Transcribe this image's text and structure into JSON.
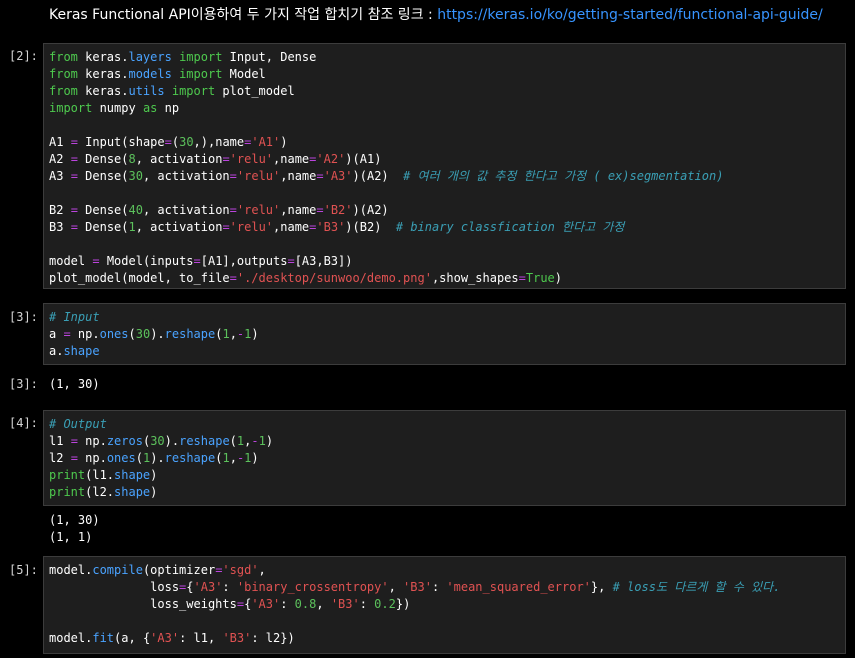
{
  "markdown": {
    "text": "Keras Functional API이용하여 두 가지 작업 합치기 참조 링크 : ",
    "link": "https://keras.io/ko/getting-started/functional-api-guide/"
  },
  "cells": [
    {
      "prompt": "[2]:",
      "lines": [
        [
          [
            "kw",
            "from"
          ],
          [
            "pl",
            " keras."
          ],
          [
            "attr",
            "layers"
          ],
          [
            "pl",
            " "
          ],
          [
            "kw",
            "import"
          ],
          [
            "pl",
            " Input, Dense"
          ]
        ],
        [
          [
            "kw",
            "from"
          ],
          [
            "pl",
            " keras."
          ],
          [
            "attr",
            "models"
          ],
          [
            "pl",
            " "
          ],
          [
            "kw",
            "import"
          ],
          [
            "pl",
            " Model"
          ]
        ],
        [
          [
            "kw",
            "from"
          ],
          [
            "pl",
            " keras."
          ],
          [
            "attr",
            "utils"
          ],
          [
            "pl",
            " "
          ],
          [
            "kw",
            "import"
          ],
          [
            "pl",
            " plot_model"
          ]
        ],
        [
          [
            "kw",
            "import"
          ],
          [
            "pl",
            " numpy "
          ],
          [
            "kw",
            "as"
          ],
          [
            "pl",
            " np"
          ]
        ],
        [],
        [
          [
            "pl",
            "A1 "
          ],
          [
            "op",
            "="
          ],
          [
            "pl",
            " Input(shape"
          ],
          [
            "op",
            "="
          ],
          [
            "pl",
            "("
          ],
          [
            "num",
            "30"
          ],
          [
            "pl",
            ",),name"
          ],
          [
            "op",
            "="
          ],
          [
            "str",
            "'A1'"
          ],
          [
            "pl",
            ")"
          ]
        ],
        [
          [
            "pl",
            "A2 "
          ],
          [
            "op",
            "="
          ],
          [
            "pl",
            " Dense("
          ],
          [
            "num",
            "8"
          ],
          [
            "pl",
            ", activation"
          ],
          [
            "op",
            "="
          ],
          [
            "str",
            "'relu'"
          ],
          [
            "pl",
            ",name"
          ],
          [
            "op",
            "="
          ],
          [
            "str",
            "'A2'"
          ],
          [
            "pl",
            ")(A1)"
          ]
        ],
        [
          [
            "pl",
            "A3 "
          ],
          [
            "op",
            "="
          ],
          [
            "pl",
            " Dense("
          ],
          [
            "num",
            "30"
          ],
          [
            "pl",
            ", activation"
          ],
          [
            "op",
            "="
          ],
          [
            "str",
            "'relu'"
          ],
          [
            "pl",
            ",name"
          ],
          [
            "op",
            "="
          ],
          [
            "str",
            "'A3'"
          ],
          [
            "pl",
            ")(A2)  "
          ],
          [
            "cm",
            "# 여러 개의 값 추정 한다고 가정 ( ex)segmentation)"
          ]
        ],
        [],
        [
          [
            "pl",
            "B2 "
          ],
          [
            "op",
            "="
          ],
          [
            "pl",
            " Dense("
          ],
          [
            "num",
            "40"
          ],
          [
            "pl",
            ", activation"
          ],
          [
            "op",
            "="
          ],
          [
            "str",
            "'relu'"
          ],
          [
            "pl",
            ",name"
          ],
          [
            "op",
            "="
          ],
          [
            "str",
            "'B2'"
          ],
          [
            "pl",
            ")(A2)"
          ]
        ],
        [
          [
            "pl",
            "B3 "
          ],
          [
            "op",
            "="
          ],
          [
            "pl",
            " Dense("
          ],
          [
            "num",
            "1"
          ],
          [
            "pl",
            ", activation"
          ],
          [
            "op",
            "="
          ],
          [
            "str",
            "'relu'"
          ],
          [
            "pl",
            ",name"
          ],
          [
            "op",
            "="
          ],
          [
            "str",
            "'B3'"
          ],
          [
            "pl",
            ")(B2)  "
          ],
          [
            "cm",
            "# binary classfication 한다고 가정"
          ]
        ],
        [],
        [
          [
            "pl",
            "model "
          ],
          [
            "op",
            "="
          ],
          [
            "pl",
            " Model(inputs"
          ],
          [
            "op",
            "="
          ],
          [
            "pl",
            "[A1],outputs"
          ],
          [
            "op",
            "="
          ],
          [
            "pl",
            "[A3,B3])"
          ]
        ],
        [
          [
            "pl",
            "plot_model(model, to_file"
          ],
          [
            "op",
            "="
          ],
          [
            "str",
            "'./desktop/sunwoo/demo.png'"
          ],
          [
            "pl",
            ",show_shapes"
          ],
          [
            "op",
            "="
          ],
          [
            "bi",
            "True"
          ],
          [
            "pl",
            ")"
          ]
        ]
      ]
    },
    {
      "prompt": "[3]:",
      "lines": [
        [
          [
            "cm",
            "# Input"
          ]
        ],
        [
          [
            "pl",
            "a "
          ],
          [
            "op",
            "="
          ],
          [
            "pl",
            " np."
          ],
          [
            "attr",
            "ones"
          ],
          [
            "pl",
            "("
          ],
          [
            "num",
            "30"
          ],
          [
            "pl",
            ")."
          ],
          [
            "attr",
            "reshape"
          ],
          [
            "pl",
            "("
          ],
          [
            "num",
            "1"
          ],
          [
            "pl",
            ","
          ],
          [
            "op",
            "-"
          ],
          [
            "num",
            "1"
          ],
          [
            "pl",
            ")"
          ]
        ],
        [
          [
            "pl",
            "a."
          ],
          [
            "attr",
            "shape"
          ]
        ]
      ]
    },
    {
      "prompt": "[4]:",
      "lines": [
        [
          [
            "cm",
            "# Output"
          ]
        ],
        [
          [
            "pl",
            "l1 "
          ],
          [
            "op",
            "="
          ],
          [
            "pl",
            " np."
          ],
          [
            "attr",
            "zeros"
          ],
          [
            "pl",
            "("
          ],
          [
            "num",
            "30"
          ],
          [
            "pl",
            ")."
          ],
          [
            "attr",
            "reshape"
          ],
          [
            "pl",
            "("
          ],
          [
            "num",
            "1"
          ],
          [
            "pl",
            ","
          ],
          [
            "op",
            "-"
          ],
          [
            "num",
            "1"
          ],
          [
            "pl",
            ")"
          ]
        ],
        [
          [
            "pl",
            "l2 "
          ],
          [
            "op",
            "="
          ],
          [
            "pl",
            " np."
          ],
          [
            "attr",
            "ones"
          ],
          [
            "pl",
            "("
          ],
          [
            "num",
            "1"
          ],
          [
            "pl",
            ")."
          ],
          [
            "attr",
            "reshape"
          ],
          [
            "pl",
            "("
          ],
          [
            "num",
            "1"
          ],
          [
            "pl",
            ","
          ],
          [
            "op",
            "-"
          ],
          [
            "num",
            "1"
          ],
          [
            "pl",
            ")"
          ]
        ],
        [
          [
            "bi",
            "print"
          ],
          [
            "pl",
            "(l1."
          ],
          [
            "attr",
            "shape"
          ],
          [
            "pl",
            ")"
          ]
        ],
        [
          [
            "bi",
            "print"
          ],
          [
            "pl",
            "(l2."
          ],
          [
            "attr",
            "shape"
          ],
          [
            "pl",
            ")"
          ]
        ]
      ]
    },
    {
      "prompt": "[5]:",
      "lines": [
        [
          [
            "pl",
            "model."
          ],
          [
            "attr",
            "compile"
          ],
          [
            "pl",
            "(optimizer"
          ],
          [
            "op",
            "="
          ],
          [
            "str",
            "'sgd'"
          ],
          [
            "pl",
            ","
          ]
        ],
        [
          [
            "pl",
            "              loss"
          ],
          [
            "op",
            "="
          ],
          [
            "pl",
            "{"
          ],
          [
            "str",
            "'A3'"
          ],
          [
            "pl",
            ": "
          ],
          [
            "str",
            "'binary_crossentropy'"
          ],
          [
            "pl",
            ", "
          ],
          [
            "str",
            "'B3'"
          ],
          [
            "pl",
            ": "
          ],
          [
            "str",
            "'mean_squared_error'"
          ],
          [
            "pl",
            "}, "
          ],
          [
            "cm",
            "# loss도 다르게 할 수 있다."
          ]
        ],
        [
          [
            "pl",
            "              loss_weights"
          ],
          [
            "op",
            "="
          ],
          [
            "pl",
            "{"
          ],
          [
            "str",
            "'A3'"
          ],
          [
            "pl",
            ": "
          ],
          [
            "num",
            "0.8"
          ],
          [
            "pl",
            ", "
          ],
          [
            "str",
            "'B3'"
          ],
          [
            "pl",
            ": "
          ],
          [
            "num",
            "0.2"
          ],
          [
            "pl",
            "})"
          ]
        ],
        [],
        [
          [
            "pl",
            "model."
          ],
          [
            "attr",
            "fit"
          ],
          [
            "pl",
            "(a, {"
          ],
          [
            "str",
            "'A3'"
          ],
          [
            "pl",
            ": l1, "
          ],
          [
            "str",
            "'B3'"
          ],
          [
            "pl",
            ": l2})"
          ]
        ]
      ]
    }
  ],
  "outputs": {
    "out3_prompt": "[3]:",
    "out3_value": "(1, 30)",
    "out4_line1": "(1, 30)",
    "out4_line2": "(1, 1)"
  },
  "colors": {
    "keyword": "#4ec94e",
    "attribute": "#4aa3ff",
    "string": "#e05252",
    "number": "#5cc15c",
    "operator": "#bb44dd",
    "comment": "#3a9fb5",
    "link": "#3794ff",
    "cell_background": "#1e1e1e"
  }
}
